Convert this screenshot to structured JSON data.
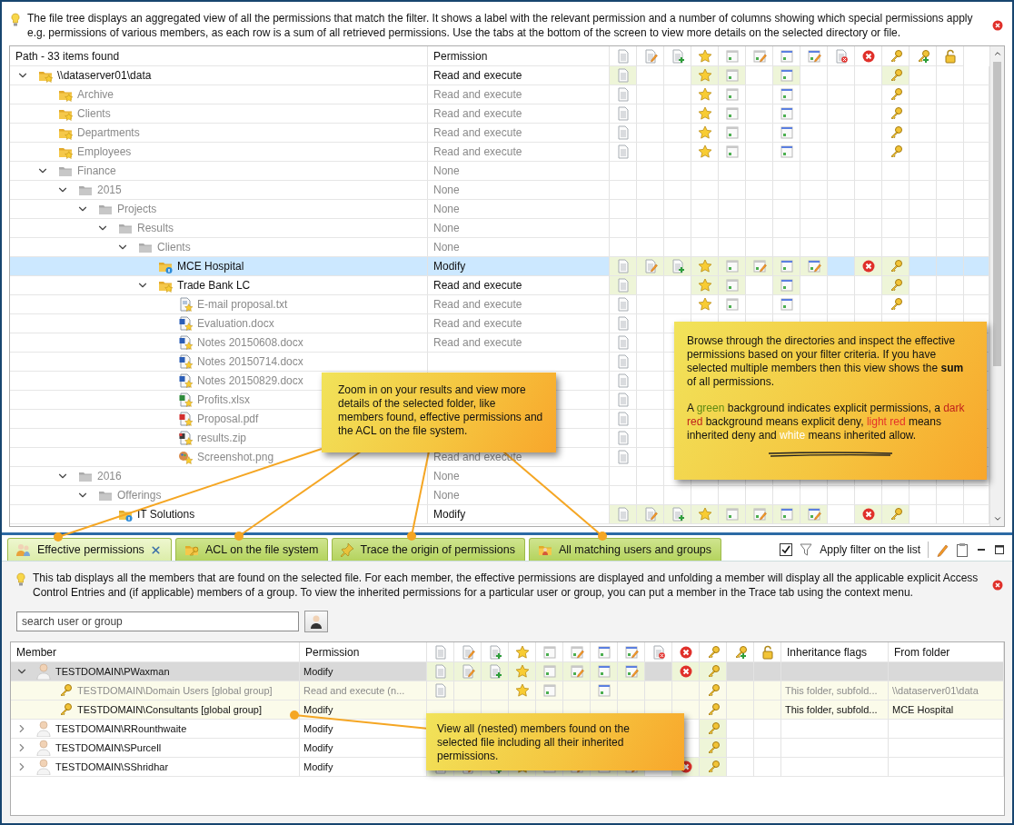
{
  "info_bar": {
    "text": "The file tree displays an aggregated view of all the permissions that match the filter. It shows a label with the relevant permission and a number of columns showing which special permissions apply e.g. permissions of various members, as each row is a sum of all retrieved permissions. Use the tabs at the bottom of the screen to view more details on the selected directory or file."
  },
  "tree_table": {
    "columns": [
      {
        "label": "Path - 33 items found"
      },
      {
        "label": "Permission"
      }
    ],
    "perm_columns": [
      {
        "kind": "read"
      },
      {
        "kind": "write"
      },
      {
        "kind": "append"
      },
      {
        "kind": "star"
      },
      {
        "kind": "list"
      },
      {
        "kind": "list-edit"
      },
      {
        "kind": "attrs"
      },
      {
        "kind": "attrs-edit"
      },
      {
        "kind": "delete"
      },
      {
        "kind": "deny"
      },
      {
        "kind": "key"
      },
      {
        "kind": "owner"
      },
      {
        "kind": "lock"
      }
    ],
    "tree": [
      {
        "name": "\\\\dataserver01\\data",
        "kind": "folder-star",
        "permission": "Read and execute",
        "inherited": false,
        "selected": false,
        "explicit": true,
        "perms": {
          "read": true,
          "star": true,
          "list": true,
          "attrs": true,
          "key": true
        },
        "expanded": true,
        "children": [
          {
            "name": "Archive",
            "kind": "folder-star",
            "permission": "Read and execute",
            "inherited": true,
            "selected": false,
            "explicit": false,
            "perms": {
              "read": true,
              "star": true,
              "list": true,
              "attrs": true,
              "key": true
            }
          },
          {
            "name": "Clients",
            "kind": "folder-star",
            "permission": "Read and execute",
            "inherited": true,
            "selected": false,
            "explicit": false,
            "perms": {
              "read": true,
              "star": true,
              "list": true,
              "attrs": true,
              "key": true
            }
          },
          {
            "name": "Departments",
            "kind": "folder-star",
            "permission": "Read and execute",
            "inherited": true,
            "selected": false,
            "explicit": false,
            "perms": {
              "read": true,
              "star": true,
              "list": true,
              "attrs": true,
              "key": true
            }
          },
          {
            "name": "Employees",
            "kind": "folder-star",
            "permission": "Read and execute",
            "inherited": true,
            "selected": false,
            "explicit": false,
            "perms": {
              "read": true,
              "star": true,
              "list": true,
              "attrs": true,
              "key": true
            }
          },
          {
            "name": "Finance",
            "kind": "folder-grey",
            "permission": "None",
            "inherited": true,
            "selected": false,
            "expanded": true,
            "children": [
              {
                "name": "2015",
                "kind": "folder-grey",
                "permission": "None",
                "inherited": true,
                "selected": false,
                "expanded": true,
                "children": [
                  {
                    "name": "Projects",
                    "kind": "folder-grey",
                    "permission": "None",
                    "inherited": true,
                    "selected": false,
                    "expanded": true,
                    "children": [
                      {
                        "name": "Results",
                        "kind": "folder-grey",
                        "permission": "None",
                        "inherited": true,
                        "selected": false,
                        "expanded": true,
                        "children": [
                          {
                            "name": "Clients",
                            "kind": "folder-grey",
                            "permission": "None",
                            "inherited": true,
                            "selected": false,
                            "expanded": true,
                            "children": [
                              {
                                "name": "MCE Hospital",
                                "kind": "folder-info",
                                "permission": "Modify",
                                "inherited": false,
                                "selected": true,
                                "explicit": true,
                                "perms": {
                                  "read": true,
                                  "write": true,
                                  "append": true,
                                  "star": true,
                                  "list": true,
                                  "list-edit": true,
                                  "attrs": true,
                                  "attrs-edit": true,
                                  "deny": true,
                                  "key": true
                                }
                              },
                              {
                                "name": "Trade Bank LC",
                                "kind": "folder-star",
                                "permission": "Read and execute",
                                "inherited": false,
                                "selected": false,
                                "explicit": true,
                                "perms": {
                                  "read": true,
                                  "star": true,
                                  "list": true,
                                  "attrs": true,
                                  "key": true
                                },
                                "expanded": true,
                                "children": [
                                  {
                                    "name": "E-mail proposal.txt",
                                    "kind": "txt",
                                    "permission": "Read and execute",
                                    "inherited": true,
                                    "selected": false,
                                    "explicit": false,
                                    "perms": {
                                      "read": true,
                                      "star": true,
                                      "list": true,
                                      "attrs": true,
                                      "key": true
                                    }
                                  },
                                  {
                                    "name": "Evaluation.docx",
                                    "kind": "word",
                                    "permission": "Read and execute",
                                    "inherited": true,
                                    "selected": false,
                                    "explicit": false,
                                    "perms": {
                                      "read": true
                                    }
                                  },
                                  {
                                    "name": "Notes 20150608.docx",
                                    "kind": "word",
                                    "permission": "Read and execute",
                                    "inherited": true,
                                    "selected": false,
                                    "explicit": false,
                                    "perms": {
                                      "read": true
                                    }
                                  },
                                  {
                                    "name": "Notes 20150714.docx",
                                    "kind": "word",
                                    "inherited": true,
                                    "selected": false,
                                    "explicit": false,
                                    "perms": {
                                      "read": true
                                    }
                                  },
                                  {
                                    "name": "Notes 20150829.docx",
                                    "kind": "word",
                                    "inherited": true,
                                    "selected": false,
                                    "explicit": false,
                                    "perms": {
                                      "read": true
                                    }
                                  },
                                  {
                                    "name": "Profits.xlsx",
                                    "kind": "excel",
                                    "inherited": true,
                                    "selected": false,
                                    "explicit": false,
                                    "perms": {
                                      "read": true
                                    }
                                  },
                                  {
                                    "name": "Proposal.pdf",
                                    "kind": "pdf",
                                    "inherited": true,
                                    "selected": false,
                                    "explicit": false,
                                    "perms": {
                                      "read": true
                                    }
                                  },
                                  {
                                    "name": "results.zip",
                                    "kind": "zip",
                                    "inherited": true,
                                    "selected": false,
                                    "explicit": false,
                                    "perms": {
                                      "read": true
                                    }
                                  },
                                  {
                                    "name": "Screenshot.png",
                                    "kind": "image",
                                    "permission": "Read and execute",
                                    "inherited": true,
                                    "selected": false,
                                    "explicit": false,
                                    "perms": {
                                      "read": true
                                    }
                                  }
                                ]
                              }
                            ]
                          }
                        ]
                      }
                    ]
                  }
                ]
              },
              {
                "name": "2016",
                "kind": "folder-grey",
                "permission": "None",
                "inherited": true,
                "selected": false,
                "expanded": true,
                "children": [
                  {
                    "name": "Offerings",
                    "kind": "folder-grey",
                    "permission": "None",
                    "inherited": true,
                    "selected": false,
                    "expanded": true,
                    "children": [
                      {
                        "name": "IT Solutions",
                        "kind": "folder-info",
                        "permission": "Modify",
                        "inherited": false,
                        "selected": false,
                        "explicit": true,
                        "perms": {
                          "read": true,
                          "write": true,
                          "append": true,
                          "star": true,
                          "list": true,
                          "list-edit": true,
                          "attrs": true,
                          "attrs-edit": true,
                          "deny": true,
                          "key": true
                        }
                      }
                    ]
                  }
                ]
              }
            ]
          }
        ]
      }
    ]
  },
  "tabs": [
    {
      "label": "Effective permissions",
      "selected": true,
      "closable": true
    },
    {
      "label": "ACL on the file system",
      "selected": false,
      "closable": false
    },
    {
      "label": "Trace the origin of permissions",
      "selected": false,
      "closable": false
    },
    {
      "label": "All matching users and groups",
      "selected": false,
      "closable": false
    }
  ],
  "filter": {
    "label": "Apply filter on the list",
    "checked": true
  },
  "tab_info": {
    "text": "This tab displays all the members that are found on the selected file. For each member, the effective permissions are displayed and unfolding a member will display all the applicable explicit Access Control Entries and (if applicable) members of a group. To view the inherited permissions for a particular user or group, you can put a member in the Trace tab using the context menu."
  },
  "search": {
    "placeholder": "search user or group"
  },
  "members": {
    "columns": [
      {
        "label": "Member"
      },
      {
        "label": "Permission"
      }
    ],
    "extra_columns": [
      {
        "label": "Inheritance flags"
      },
      {
        "label": "From folder"
      }
    ],
    "rows": [
      {
        "name": "TESTDOMAIN\\PWaxman",
        "kind": "user",
        "permission": "Modify",
        "inherited": false,
        "selected": true,
        "expanded": true,
        "perms": {
          "read": true,
          "write": true,
          "append": true,
          "star": true,
          "list": true,
          "list-edit": true,
          "attrs": true,
          "attrs-edit": true,
          "deny": true,
          "key": true
        },
        "children": [
          {
            "name": "TESTDOMAIN\\Domain Users [global group]",
            "kind": "group",
            "permission": "Read and execute (n...",
            "inherited": true,
            "selected": false,
            "perms": {
              "read": true,
              "star": true,
              "list": true,
              "attrs": true,
              "key": true
            },
            "flags": "This folder, subfold...",
            "from": "\\\\dataserver01\\data"
          },
          {
            "name": "TESTDOMAIN\\Consultants [global group]",
            "kind": "group",
            "permission": "Modify",
            "inherited": false,
            "selected": false,
            "perms": {
              "key": true
            },
            "flags": "This folder, subfold...",
            "from": "MCE Hospital"
          }
        ]
      },
      {
        "name": "TESTDOMAIN\\RRounthwaite",
        "kind": "user",
        "permission": "Modify",
        "inherited": false,
        "selected": false,
        "expanded": false,
        "perms": {
          "key": true
        }
      },
      {
        "name": "TESTDOMAIN\\SPurcell",
        "kind": "user",
        "permission": "Modify",
        "inherited": false,
        "selected": false,
        "expanded": false,
        "perms": {
          "key": true
        }
      },
      {
        "name": "TESTDOMAIN\\SShridhar",
        "kind": "user",
        "permission": "Modify",
        "inherited": false,
        "selected": false,
        "expanded": false,
        "perms": {
          "read": true,
          "write": true,
          "append": true,
          "star": true,
          "list": true,
          "list-edit": true,
          "attrs": true,
          "attrs-edit": true,
          "deny": true,
          "key": true
        }
      }
    ]
  },
  "callouts": [
    {
      "paragraphs": [
        [
          {
            "text": "Zoom in on your results and view more details of the selected folder, like members found, effective permissions and the ACL on the file system."
          }
        ]
      ]
    },
    {
      "paragraphs": [
        [
          {
            "text": "Browse through the directories and inspect the effective permissions based on your filter criteria. If you have selected multiple members then this view shows the **sum** of all permissions."
          }
        ],
        [
          {
            "text": "A "
          },
          {
            "text": "green",
            "color": "#5f8a12"
          },
          {
            "text": " background indicates explicit permissions, a "
          },
          {
            "text": "dark red",
            "color": "#c0221c"
          },
          {
            "text": " background means explicit deny, "
          },
          {
            "text": "light red",
            "color": "#e5322a"
          },
          {
            "text": " means inherited deny and "
          },
          {
            "text": "white",
            "color": "#ffffff"
          },
          {
            "text": " means inherited allow."
          }
        ]
      ]
    },
    {
      "paragraphs": [
        [
          {
            "text": "View all (nested) members found on the selected file including all their inherited permissions."
          }
        ]
      ]
    }
  ]
}
